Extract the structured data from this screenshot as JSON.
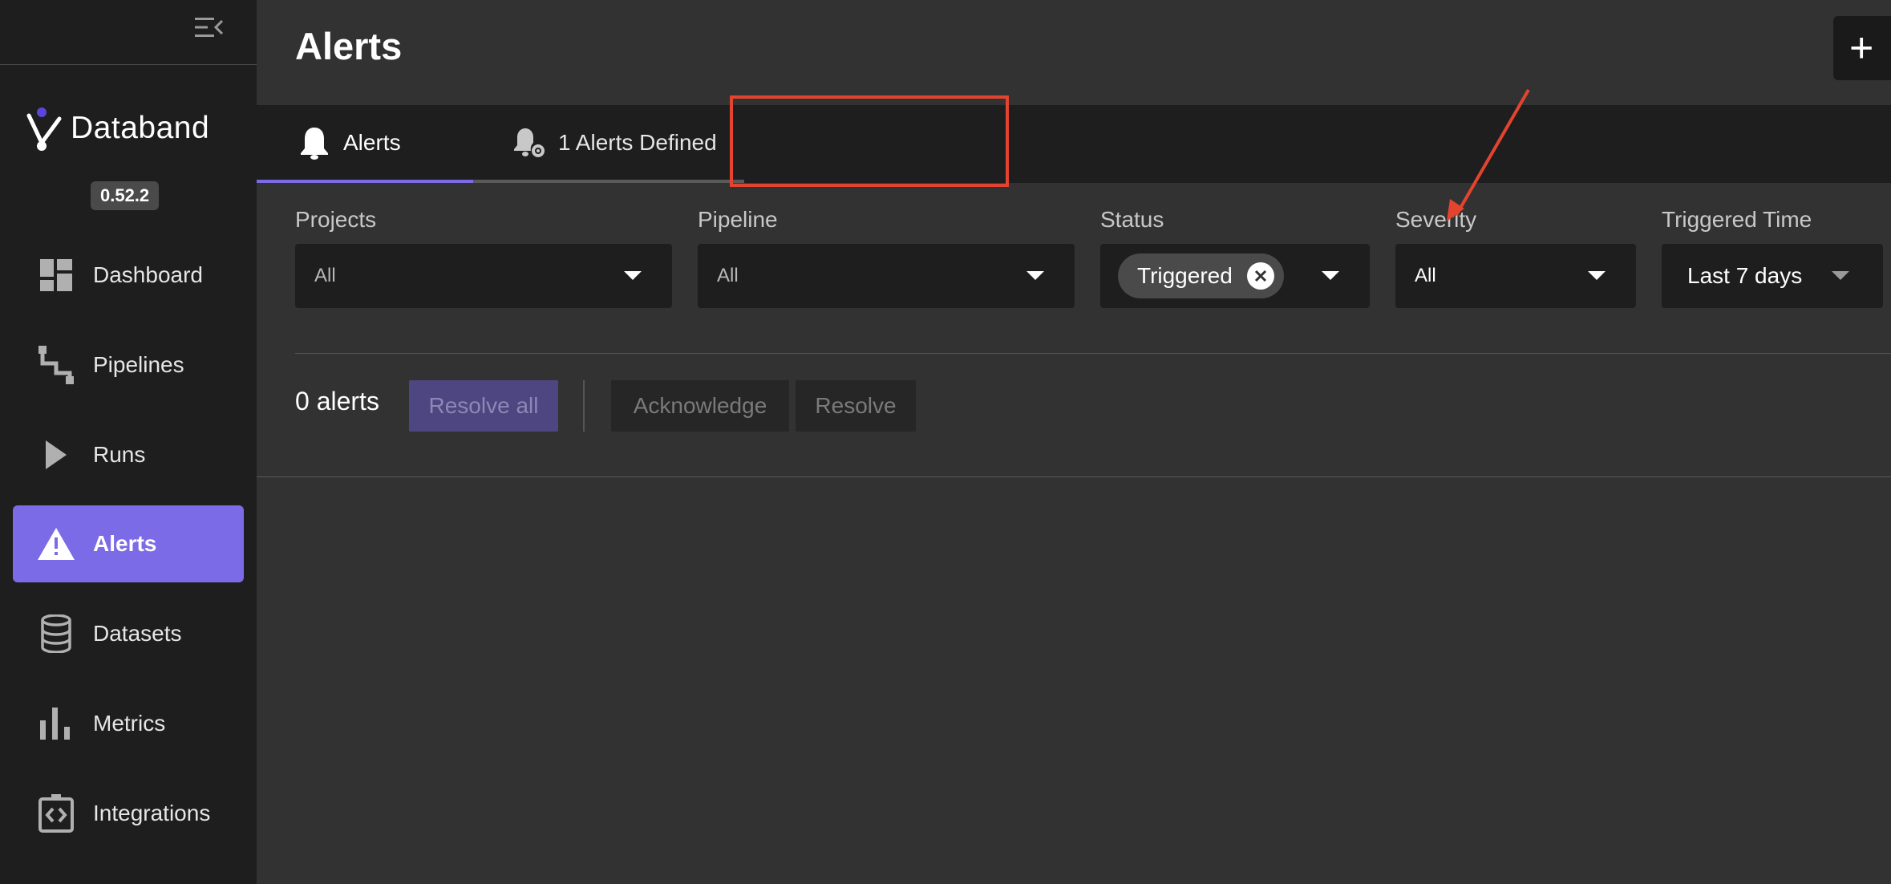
{
  "app": {
    "name": "Databand",
    "version": "0.52.2"
  },
  "sidebar": {
    "items": [
      {
        "label": "Dashboard",
        "icon": "dashboard-icon"
      },
      {
        "label": "Pipelines",
        "icon": "pipeline-icon"
      },
      {
        "label": "Runs",
        "icon": "play-icon"
      },
      {
        "label": "Alerts",
        "icon": "warning-icon",
        "active": true
      },
      {
        "label": "Datasets",
        "icon": "database-icon"
      },
      {
        "label": "Metrics",
        "icon": "bar-chart-icon"
      },
      {
        "label": "Integrations",
        "icon": "integrations-icon"
      }
    ]
  },
  "header": {
    "title": "Alerts",
    "add_label": "+"
  },
  "tabs": [
    {
      "label": "Alerts",
      "icon": "bell-icon",
      "active": true
    },
    {
      "label": "1 Alerts Defined",
      "icon": "bell-settings-icon",
      "active": false
    }
  ],
  "filters": {
    "projects": {
      "label": "Projects",
      "value": "All"
    },
    "pipeline": {
      "label": "Pipeline",
      "value": "All"
    },
    "status": {
      "label": "Status",
      "chip": "Triggered"
    },
    "severity": {
      "label": "Severity",
      "value": "All"
    },
    "triggered_time": {
      "label": "Triggered Time",
      "value": "Last 7 days"
    }
  },
  "actions": {
    "count": "0 alerts",
    "resolve_all": "Resolve all",
    "acknowledge": "Acknowledge",
    "resolve": "Resolve"
  },
  "colors": {
    "accent": "#7b6be6",
    "annotation": "#e2442f",
    "sidebar_bg": "#1e1e1e",
    "main_bg": "#323232"
  }
}
